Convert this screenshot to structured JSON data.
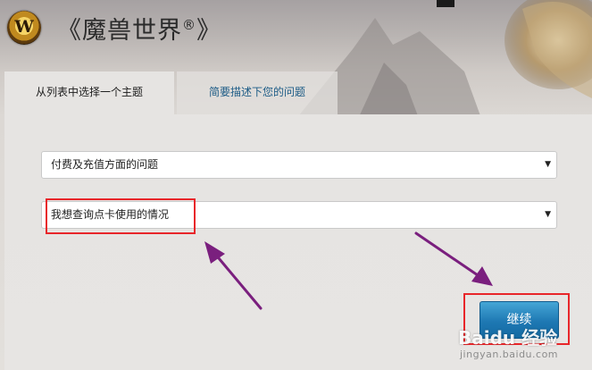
{
  "header": {
    "logo_glyph": "W",
    "title": "《魔兽世界",
    "title_reg": "®",
    "title_close": "》"
  },
  "tabs": [
    {
      "label": "从列表中选择一个主题",
      "active": true
    },
    {
      "label": "简要描述下您的问题",
      "active": false
    }
  ],
  "form": {
    "category_select": {
      "value": "付费及充值方面的问题",
      "arrow": "▼"
    },
    "topic_select": {
      "value": "我想查询点卡使用的情况",
      "arrow": "▼"
    },
    "continue_label": "继续"
  },
  "watermark": {
    "logo_text": "Baidu 经验",
    "url": "jingyan.baidu.com"
  },
  "colors": {
    "highlight_box": "#e8262a",
    "annotation_arrow": "#7a1f7e",
    "tab_link": "#1c5b86",
    "button": "#1e78b3"
  },
  "icons": [
    "wow-logo-icon",
    "dropdown-arrow-icon",
    "annotation-arrow-icon"
  ]
}
